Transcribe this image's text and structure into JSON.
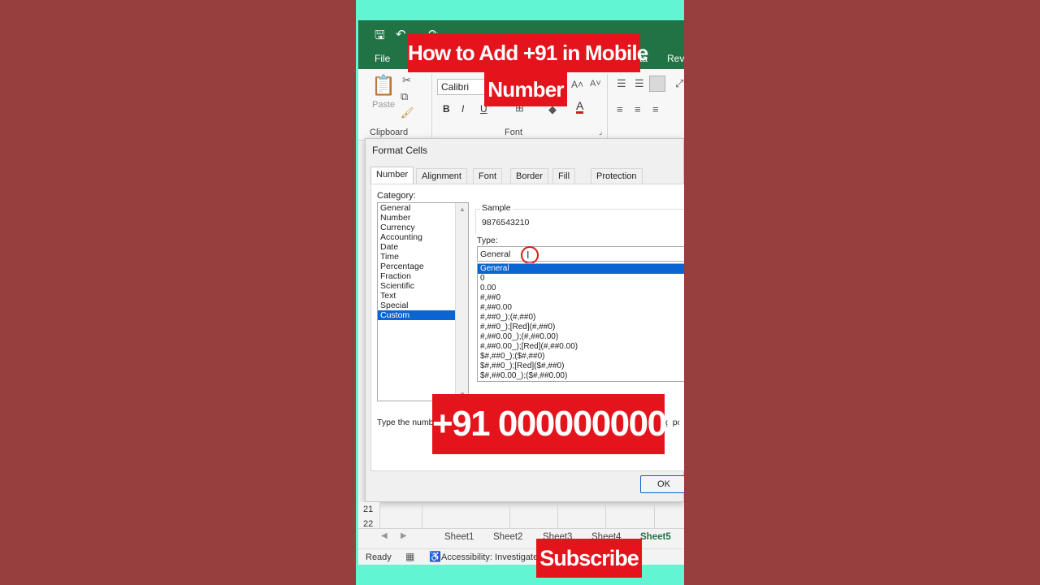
{
  "ribbon": {
    "tabs": [
      "File",
      "ta",
      "Revi"
    ],
    "clipboard": {
      "paste_label": "Paste",
      "group_label": "Clipboard"
    },
    "font": {
      "font_name": "Calibri",
      "group_label": "Font",
      "bold": "B",
      "italic": "I",
      "underline": "U",
      "font_color": "A"
    }
  },
  "dialog": {
    "title": "Format Cells",
    "tabs": [
      "Number",
      "Alignment",
      "Font",
      "Border",
      "Fill",
      "Protection"
    ],
    "category_label": "Category:",
    "categories": [
      "General",
      "Number",
      "Currency",
      "Accounting",
      "Date",
      "Time",
      "Percentage",
      "Fraction",
      "Scientific",
      "Text",
      "Special",
      "Custom"
    ],
    "selected_category": "Custom",
    "sample_label": "Sample",
    "sample_value": "9876543210",
    "type_label": "Type:",
    "type_value": "General",
    "type_options": [
      "General",
      "0",
      "0.00",
      "#,##0",
      "#,##0.00",
      "#,##0_);(#,##0)",
      "#,##0_);[Red](#,##0)",
      "#,##0.00_);(#,##0.00)",
      "#,##0.00_);[Red](#,##0.00)",
      "$#,##0_);($#,##0)",
      "$#,##0_);[Red]($#,##0)",
      "$#,##0.00_);($#,##0.00)"
    ],
    "hint_text": "Type the numb",
    "hint_text_right": "g poi",
    "ok_label": "OK"
  },
  "sheet": {
    "rows": [
      "21",
      "22"
    ],
    "sheet_tabs": [
      "Sheet1",
      "Sheet2",
      "Sheet3",
      "Sheet4",
      "Sheet5"
    ],
    "active_sheet": "Sheet5"
  },
  "status": {
    "ready": "Ready",
    "accessibility": "Accessibility: Investigate"
  },
  "overlay": {
    "title_line1": "How to Add +91 in Mobile",
    "title_line2": "Number",
    "number_banner": "+91 0000000000",
    "subscribe": "Subscribe"
  },
  "colors": {
    "background": "#973f3f",
    "stage": "#62f5d4",
    "excel_green": "#217346",
    "banner_red": "#e4141c",
    "selection_blue": "#0a64d2"
  }
}
